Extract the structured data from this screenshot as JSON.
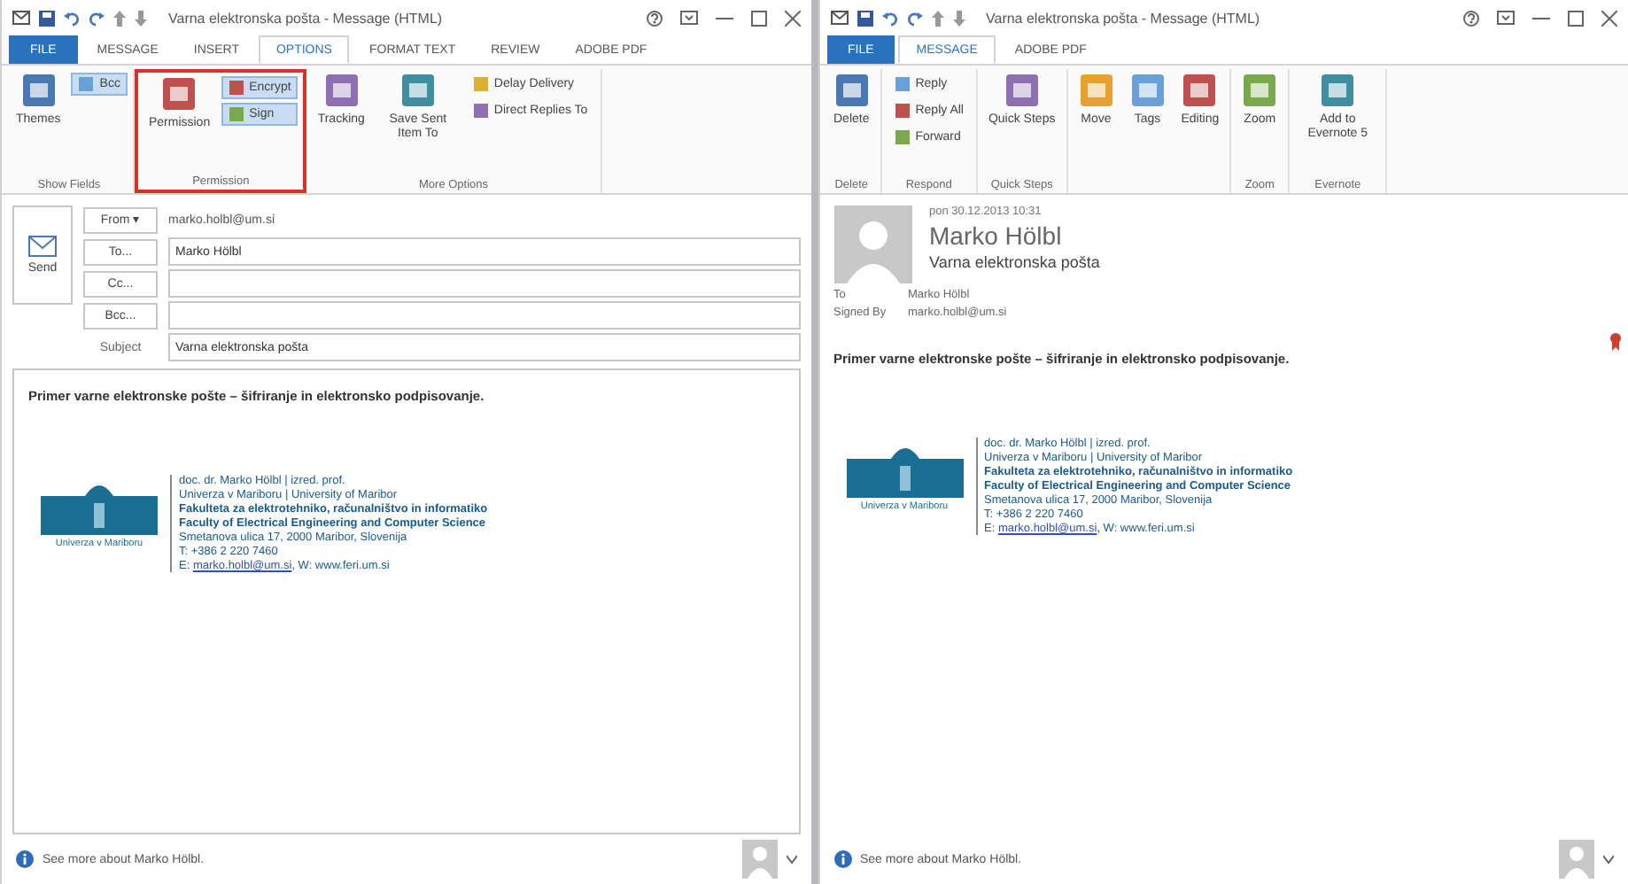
{
  "compose": {
    "title": "Varna elektronska pošta - Message (HTML)",
    "tabs": [
      {
        "label": "FILE",
        "selected": false,
        "kind": "file"
      },
      {
        "label": "MESSAGE",
        "selected": false,
        "kind": "tab"
      },
      {
        "label": "INSERT",
        "selected": false,
        "kind": "tab"
      },
      {
        "label": "OPTIONS",
        "selected": true,
        "kind": "tab"
      },
      {
        "label": "FORMAT TEXT",
        "selected": false,
        "kind": "tab"
      },
      {
        "label": "REVIEW",
        "selected": false,
        "kind": "tab"
      },
      {
        "label": "ADOBE PDF",
        "selected": false,
        "kind": "tab"
      }
    ],
    "groups": [
      {
        "label": "Show Fields",
        "highlighted": false,
        "items": [
          {
            "label": "Themes",
            "kind": "large"
          },
          {
            "label": "Bcc",
            "kind": "small",
            "on": true
          }
        ]
      },
      {
        "label": "Permission",
        "highlighted": true,
        "items": [
          {
            "label": "Permission",
            "kind": "large"
          },
          {
            "label": "Encrypt",
            "kind": "small",
            "on": true
          },
          {
            "label": "Sign",
            "kind": "small",
            "on": true
          }
        ]
      },
      {
        "label": "More Options",
        "highlighted": false,
        "items": [
          {
            "label": "Tracking",
            "kind": "large"
          },
          {
            "label": "Save Sent Item To",
            "kind": "large"
          },
          {
            "label": "Delay Delivery",
            "kind": "small",
            "on": false
          },
          {
            "label": "Direct Replies To",
            "kind": "small",
            "on": false
          }
        ]
      }
    ],
    "send": "Send",
    "fields": [
      {
        "button": "From ▾",
        "value": "marko.holbl@um.si",
        "kind": "plain"
      },
      {
        "button": "To...",
        "value": "Marko Hölbl",
        "kind": "box"
      },
      {
        "button": "Cc...",
        "kind": "box"
      },
      {
        "button": "Bcc...",
        "kind": "box"
      },
      {
        "label": "Subject",
        "value": "Varna elektronska pošta",
        "kind": "box"
      }
    ],
    "body": "Primer varne elektronske pošte – šifriranje in elektronsko podpisovanje.",
    "logo_caption": "Univerza v Mariboru",
    "signature": [
      {
        "text": "doc. dr. Marko Hölbl | izred. prof.",
        "kind": "plain"
      },
      {
        "text": "Univerza v Mariboru | University of Maribor",
        "kind": "plain"
      },
      {
        "text": "Fakulteta za elektrotehniko, računalništvo in informatiko",
        "kind": "bold"
      },
      {
        "text": "Faculty of Electrical Engineering and Computer Science",
        "kind": "bold"
      },
      {
        "text": "Smetanova ulica 17, 2000 Maribor, Slovenija",
        "kind": "plain"
      },
      {
        "text": "T: +386 2 220 7460",
        "kind": "plain"
      },
      {
        "prefix": "E:",
        "link": "marko.holbl@um.si",
        "suffix": ", W: www.feri.um.si",
        "kind": "link"
      }
    ],
    "status": "See more about Marko Hölbl."
  },
  "reader": {
    "title": "Varna elektronska pošta - Message (HTML)",
    "tabs": [
      {
        "label": "FILE",
        "selected": false,
        "kind": "file"
      },
      {
        "label": "MESSAGE",
        "selected": true,
        "kind": "tab"
      },
      {
        "label": "ADOBE PDF",
        "selected": false,
        "kind": "tab"
      }
    ],
    "groups": [
      {
        "label": "Delete",
        "highlighted": false,
        "items": [
          {
            "label": "Delete",
            "kind": "large"
          }
        ]
      },
      {
        "label": "Respond",
        "highlighted": false,
        "items": [
          {
            "label": "Reply",
            "kind": "small",
            "on": false
          },
          {
            "label": "Reply All",
            "kind": "small",
            "on": false
          },
          {
            "label": "Forward",
            "kind": "small",
            "on": false
          }
        ]
      },
      {
        "label": "Quick Steps",
        "highlighted": false,
        "items": [
          {
            "label": "Quick Steps",
            "kind": "large"
          }
        ]
      },
      {
        "highlighted": false,
        "items": [
          {
            "label": "Move",
            "kind": "large"
          },
          {
            "label": "Tags",
            "kind": "large"
          },
          {
            "label": "Editing",
            "kind": "large"
          }
        ]
      },
      {
        "label": "Zoom",
        "highlighted": false,
        "items": [
          {
            "label": "Zoom",
            "kind": "large"
          }
        ]
      },
      {
        "label": "Evernote",
        "highlighted": false,
        "items": [
          {
            "label": "Add to Evernote 5",
            "kind": "large"
          }
        ]
      }
    ],
    "date": "pon 30.12.2013 10:31",
    "sender": "Marko Hölbl",
    "subject": "Varna elektronska pošta",
    "meta": [
      {
        "label": "To",
        "value": "Marko Hölbl"
      },
      {
        "label": "Signed By",
        "value": "marko.holbl@um.si"
      }
    ],
    "body": "Primer varne elektronske pošte – šifriranje in elektronsko podpisovanje.",
    "logo_caption": "Univerza v Mariboru",
    "signature": [
      {
        "text": "doc. dr. Marko Hölbl | izred. prof.",
        "kind": "plain"
      },
      {
        "text": "Univerza v Mariboru | University of Maribor",
        "kind": "plain"
      },
      {
        "text": "Fakulteta za elektrotehniko, računalništvo in informatiko",
        "kind": "bold"
      },
      {
        "text": "Faculty of Electrical Engineering and Computer Science",
        "kind": "bold"
      },
      {
        "text": "Smetanova ulica 17, 2000 Maribor, Slovenija",
        "kind": "plain"
      },
      {
        "text": "T: +386 2 220 7460",
        "kind": "plain"
      },
      {
        "prefix": "E:",
        "link": "marko.holbl@um.si",
        "suffix": ", W: www.feri.um.si",
        "kind": "link"
      }
    ],
    "status": "See more about Marko Hölbl."
  }
}
